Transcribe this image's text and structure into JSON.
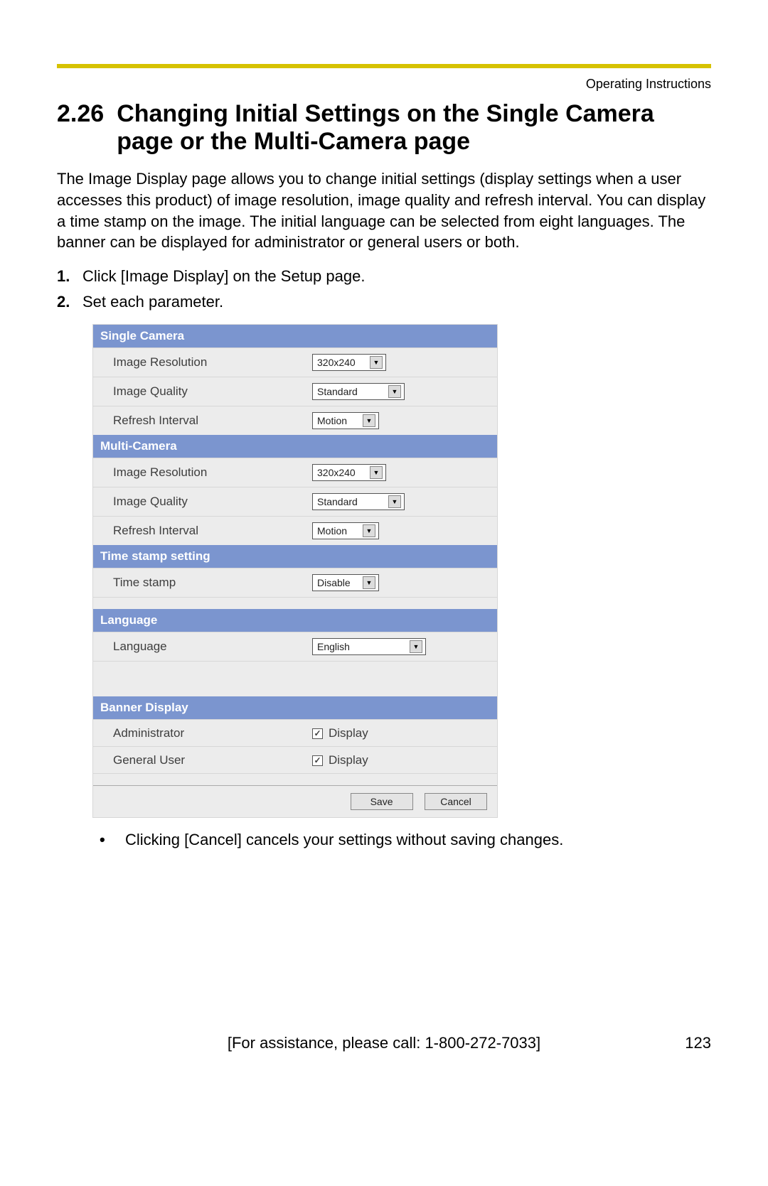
{
  "header": {
    "label": "Operating Instructions"
  },
  "title": {
    "number": "2.26",
    "text": "Changing Initial Settings on the Single Camera page or the Multi-Camera page"
  },
  "intro": "The Image Display page allows you to change initial settings (display settings when a user accesses this product) of image resolution, image quality and refresh interval. You can display a time stamp on the image. The initial language can be selected from eight languages. The banner can be displayed for administrator or general users or both.",
  "steps": {
    "s1": {
      "num": "1.",
      "text": "Click [Image Display] on the Setup page."
    },
    "s2": {
      "num": "2.",
      "text": "Set each parameter."
    }
  },
  "panel": {
    "single_camera": {
      "header": "Single Camera",
      "resolution_label": "Image Resolution",
      "resolution_value": "320x240",
      "quality_label": "Image Quality",
      "quality_value": "Standard",
      "refresh_label": "Refresh Interval",
      "refresh_value": "Motion"
    },
    "multi_camera": {
      "header": "Multi-Camera",
      "resolution_label": "Image Resolution",
      "resolution_value": "320x240",
      "quality_label": "Image Quality",
      "quality_value": "Standard",
      "refresh_label": "Refresh Interval",
      "refresh_value": "Motion"
    },
    "timestamp": {
      "header": "Time stamp setting",
      "label": "Time stamp",
      "value": "Disable"
    },
    "language": {
      "header": "Language",
      "label": "Language",
      "value": "English"
    },
    "banner": {
      "header": "Banner Display",
      "admin_label": "Administrator",
      "admin_check_label": "Display",
      "general_label": "General User",
      "general_check_label": "Display"
    },
    "buttons": {
      "save": "Save",
      "cancel": "Cancel"
    }
  },
  "note": "Clicking [Cancel] cancels your settings without saving changes.",
  "footer": {
    "assistance": "[For assistance, please call: 1-800-272-7033]",
    "page": "123"
  }
}
